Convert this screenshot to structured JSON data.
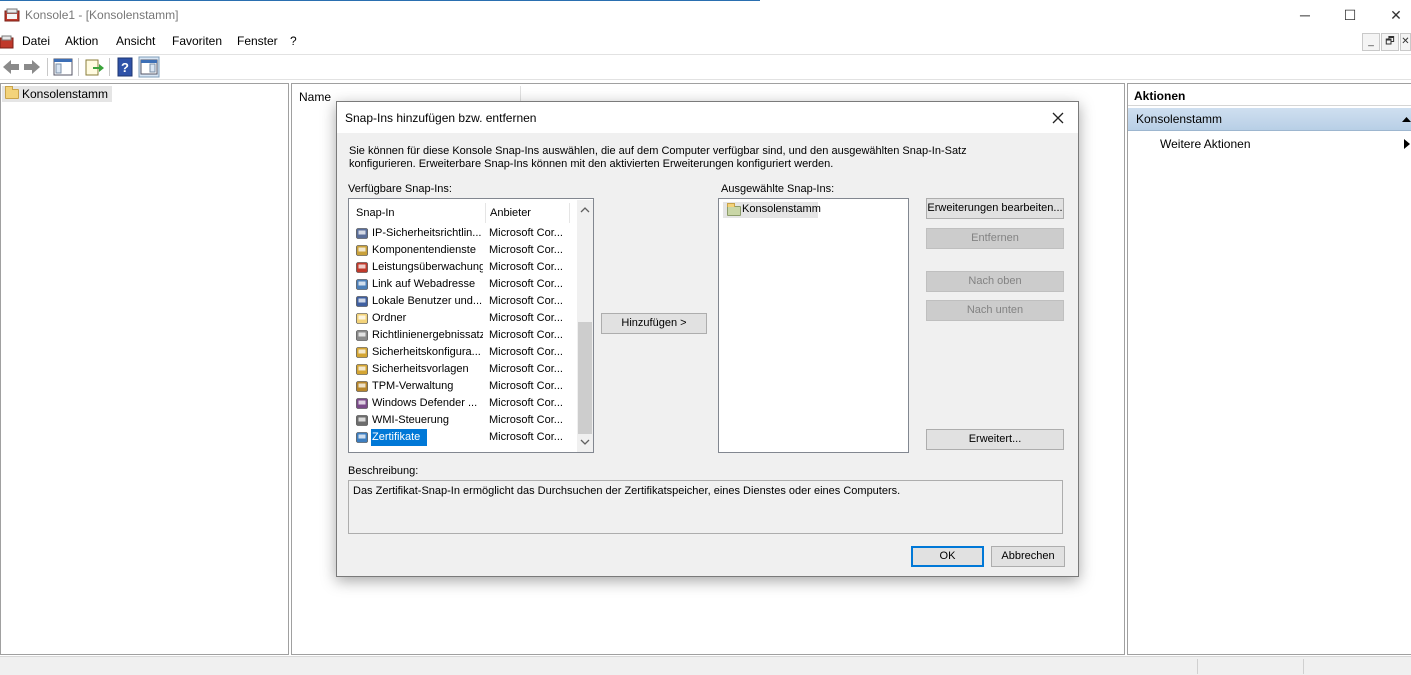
{
  "window": {
    "title": "Konsole1 - [Konsolenstamm]",
    "minimize_glyph": "─",
    "maximize_glyph": "☐",
    "close_glyph": "✕"
  },
  "menu": [
    "Datei",
    "Aktion",
    "Ansicht",
    "Favoriten",
    "Fenster",
    "?"
  ],
  "mdi_buttons": [
    "_",
    "🗗",
    "✕"
  ],
  "toolbar": {
    "icons": [
      "back-arrow-icon",
      "forward-arrow-icon",
      "show-hide-tree-icon",
      "export-list-icon",
      "help-icon",
      "show-hide-action-pane-icon"
    ]
  },
  "tree": {
    "root_label": "Konsolenstamm"
  },
  "center": {
    "column_name": "Name"
  },
  "actions_pane": {
    "header": "Aktionen",
    "section": "Konsolenstamm",
    "more": "Weitere Aktionen"
  },
  "dialog": {
    "title": "Snap-Ins hinzufügen bzw. entfernen",
    "intro_line1": "Sie können für diese Konsole Snap-Ins auswählen, die auf dem Computer verfügbar sind, und den ausgewählten Snap-In-Satz",
    "intro_line2": "konfigurieren. Erweiterbare Snap-Ins können mit den aktivierten Erweiterungen konfiguriert werden.",
    "available_label": "Verfügbare Snap-Ins:",
    "selected_label": "Ausgewählte Snap-Ins:",
    "col_snapin": "Snap-In",
    "col_vendor": "Anbieter",
    "available_items": [
      {
        "name": "IP-Sicherheitsrichtlin...",
        "vendor": "Microsoft Cor...",
        "icon": "ip-security-icon"
      },
      {
        "name": "Komponentendienste",
        "vendor": "Microsoft Cor...",
        "icon": "component-services-icon"
      },
      {
        "name": "Leistungsüberwachung",
        "vendor": "Microsoft Cor...",
        "icon": "performance-monitor-icon"
      },
      {
        "name": "Link auf Webadresse",
        "vendor": "Microsoft Cor...",
        "icon": "web-link-icon"
      },
      {
        "name": "Lokale Benutzer und...",
        "vendor": "Microsoft Cor...",
        "icon": "local-users-icon"
      },
      {
        "name": "Ordner",
        "vendor": "Microsoft Cor...",
        "icon": "folder-icon"
      },
      {
        "name": "Richtlinienergebnissatz",
        "vendor": "Microsoft Cor...",
        "icon": "policy-result-icon"
      },
      {
        "name": "Sicherheitskonfigura...",
        "vendor": "Microsoft Cor...",
        "icon": "security-config-icon"
      },
      {
        "name": "Sicherheitsvorlagen",
        "vendor": "Microsoft Cor...",
        "icon": "security-templates-icon"
      },
      {
        "name": "TPM-Verwaltung",
        "vendor": "Microsoft Cor...",
        "icon": "tpm-icon"
      },
      {
        "name": "Windows Defender ...",
        "vendor": "Microsoft Cor...",
        "icon": "windows-defender-icon"
      },
      {
        "name": "WMI-Steuerung",
        "vendor": "Microsoft Cor...",
        "icon": "wmi-icon"
      },
      {
        "name": "Zertifikate",
        "vendor": "Microsoft Cor...",
        "icon": "certificates-icon",
        "selected": true
      }
    ],
    "selected_items": [
      "Konsolenstamm"
    ],
    "buttons": {
      "add": "Hinzufügen >",
      "edit_extensions": "Erweiterungen bearbeiten...",
      "remove": "Entfernen",
      "move_up": "Nach oben",
      "move_down": "Nach unten",
      "advanced": "Erweitert...",
      "ok": "OK",
      "cancel": "Abbrechen"
    },
    "description_label": "Beschreibung:",
    "description_text": "Das Zertifikat-Snap-In ermöglicht das Durchsuchen der Zertifikatspeicher, eines Dienstes oder eines Computers."
  },
  "colors": {
    "selection": "#0078d7",
    "actions_section": "#c4d7ec"
  }
}
